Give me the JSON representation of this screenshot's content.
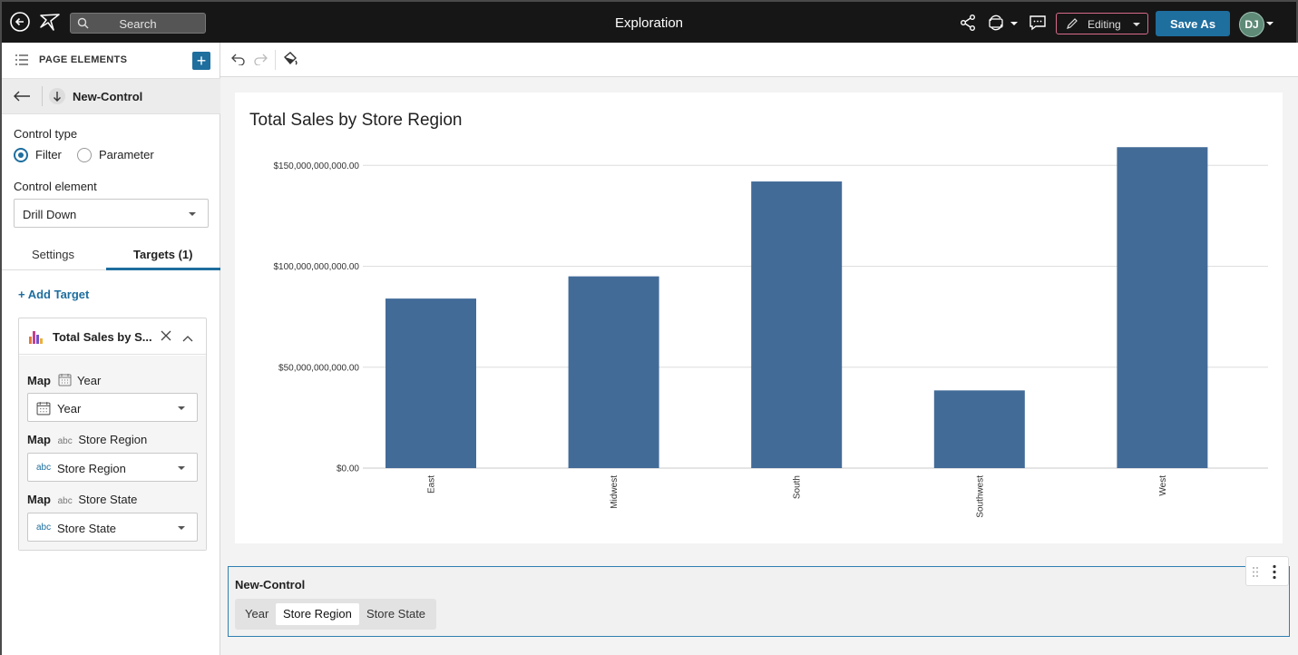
{
  "topbar": {
    "search_placeholder": "Search",
    "title": "Exploration",
    "editing_label": "Editing",
    "save_as_label": "Save As",
    "avatar_initials": "DJ"
  },
  "left_panel": {
    "header_label": "PAGE ELEMENTS",
    "control_name": "New-Control",
    "control_type_label": "Control type",
    "control_type_options": [
      "Filter",
      "Parameter"
    ],
    "control_type_selected": "Filter",
    "control_element_label": "Control element",
    "control_element_value": "Drill Down",
    "tabs": [
      "Settings",
      "Targets (1)"
    ],
    "active_tab": "Targets (1)",
    "add_target_label": "+ Add Target",
    "target": {
      "name": "Total Sales by S...",
      "map_word": "Map",
      "mappings": [
        {
          "label": "Year",
          "value": "Year",
          "kind": "date"
        },
        {
          "label": "Store Region",
          "value": "Store Region",
          "kind": "text",
          "type_tag": "abc"
        },
        {
          "label": "Store State",
          "value": "Store State",
          "kind": "text",
          "type_tag": "abc"
        }
      ]
    }
  },
  "chart_data": {
    "type": "bar",
    "title": "Total Sales by Store Region",
    "categories": [
      "East",
      "Midwest",
      "South",
      "Southwest",
      "West"
    ],
    "values": [
      84000000000,
      95000000000,
      142000000000,
      38500000000,
      159000000000
    ],
    "ylim": [
      0,
      160000000000
    ],
    "yticks": [
      0,
      50000000000,
      100000000000,
      150000000000
    ],
    "ytick_labels": [
      "$0.00",
      "$50,000,000,000.00",
      "$100,000,000,000.00",
      "$150,000,000,000.00"
    ],
    "xlabel": "",
    "ylabel": "",
    "bar_color": "#436b98",
    "grid": true
  },
  "control_strip": {
    "name": "New-Control",
    "levels": [
      "Year",
      "Store Region",
      "Store State"
    ],
    "active_level": "Store Region"
  },
  "colors": {
    "accent": "#1e6e9e",
    "topbar_bg": "#161616",
    "editing_border": "#d86a8a"
  }
}
